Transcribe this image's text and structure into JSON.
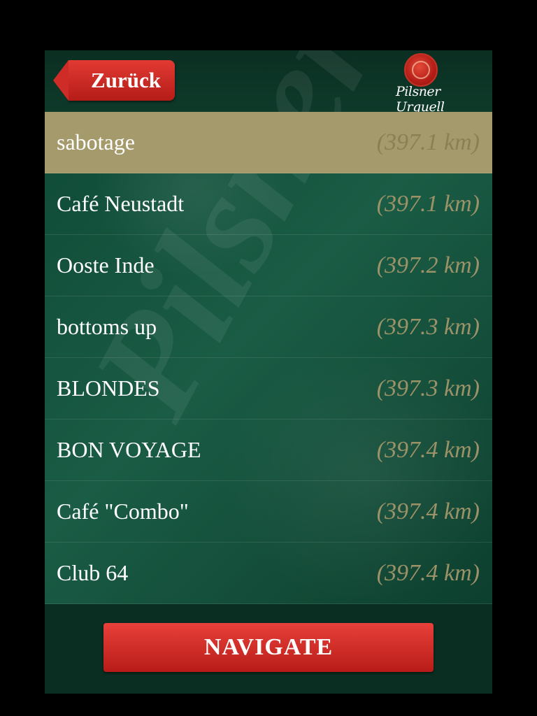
{
  "header": {
    "back_label": "Zurück",
    "logo_text": "Pilsner Urquell"
  },
  "list": {
    "items": [
      {
        "name": "sabotage",
        "distance": "(397.1 km)",
        "selected": true
      },
      {
        "name": "Café Neustadt",
        "distance": "(397.1 km)"
      },
      {
        "name": "Ooste Inde",
        "distance": "(397.2 km)"
      },
      {
        "name": "bottoms up",
        "distance": "(397.3 km)"
      },
      {
        "name": "BLONDES",
        "distance": "(397.3 km)"
      },
      {
        "name": "BON VOYAGE",
        "distance": "(397.4 km)"
      },
      {
        "name": "Café \"Combo\"",
        "distance": "(397.4 km)"
      },
      {
        "name": "Club 64",
        "distance": "(397.4 km)"
      }
    ]
  },
  "footer": {
    "navigate_label": "NAVIGATE"
  },
  "colors": {
    "background": "#0d3b2c",
    "selected_row": "#a59a6b",
    "button_red": "#d02c27",
    "distance_text": "#9c9268"
  }
}
